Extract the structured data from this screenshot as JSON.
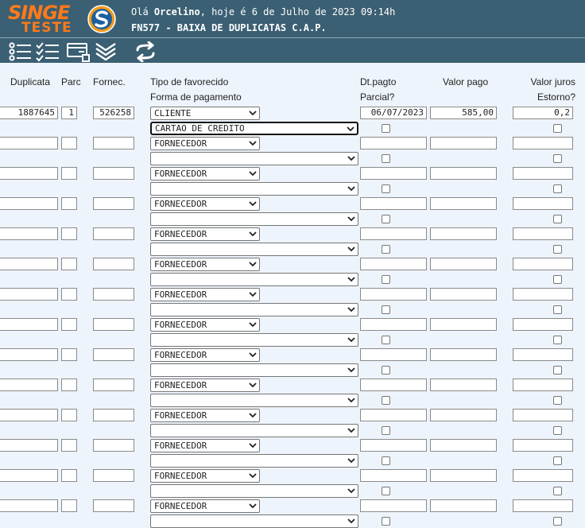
{
  "header": {
    "logo_line1": "SINGE",
    "logo_line2": "TESTE",
    "greeting_prefix": "Olá ",
    "user_name": "Orcelino",
    "greeting_suffix": ", hoje é 6 de Julho de 2023 09:14h",
    "program_title": "FN577 - BAIXA DE DUPLICATAS C.A.P."
  },
  "toolbar": {
    "icons": [
      "list-icon",
      "checklist-icon",
      "card-icon",
      "double-chevron-down-icon",
      "swap-arrows-icon"
    ]
  },
  "columns": {
    "duplicata": "Duplicata",
    "parc": "Parc",
    "fornec": "Fornec.",
    "tipo_favorecido": "Tipo de favorecido",
    "forma_pagamento": "Forma de pagamento",
    "dt_pagto": "Dt.pagto",
    "parcial": "Parcial?",
    "valor_pago": "Valor pago",
    "valor_juros": "Valor juros",
    "estorno": "Estorno?"
  },
  "colors": {
    "header_bg": "#3b5f73",
    "logo": "#ff7a1a",
    "page_bg": "#eef4fb"
  },
  "rows": [
    {
      "duplicata": "1887645",
      "parc": "1",
      "fornec": "526258",
      "tipo": "CLIENTE",
      "forma": "CARTAO DE CREDITO",
      "dt_pagto": "06/07/2023",
      "valor_pago": "585,00",
      "valor_juros": "0,2",
      "parcial": false,
      "estorno": false,
      "forma_focused": true
    },
    {
      "duplicata": "",
      "parc": "",
      "fornec": "",
      "tipo": "FORNECEDOR",
      "forma": "",
      "dt_pagto": "",
      "valor_pago": "",
      "valor_juros": "",
      "parcial": false,
      "estorno": false
    },
    {
      "duplicata": "",
      "parc": "",
      "fornec": "",
      "tipo": "FORNECEDOR",
      "forma": "",
      "dt_pagto": "",
      "valor_pago": "",
      "valor_juros": "",
      "parcial": false,
      "estorno": false
    },
    {
      "duplicata": "",
      "parc": "",
      "fornec": "",
      "tipo": "FORNECEDOR",
      "forma": "",
      "dt_pagto": "",
      "valor_pago": "",
      "valor_juros": "",
      "parcial": false,
      "estorno": false
    },
    {
      "duplicata": "",
      "parc": "",
      "fornec": "",
      "tipo": "FORNECEDOR",
      "forma": "",
      "dt_pagto": "",
      "valor_pago": "",
      "valor_juros": "",
      "parcial": false,
      "estorno": false
    },
    {
      "duplicata": "",
      "parc": "",
      "fornec": "",
      "tipo": "FORNECEDOR",
      "forma": "",
      "dt_pagto": "",
      "valor_pago": "",
      "valor_juros": "",
      "parcial": false,
      "estorno": false
    },
    {
      "duplicata": "",
      "parc": "",
      "fornec": "",
      "tipo": "FORNECEDOR",
      "forma": "",
      "dt_pagto": "",
      "valor_pago": "",
      "valor_juros": "",
      "parcial": false,
      "estorno": false
    },
    {
      "duplicata": "",
      "parc": "",
      "fornec": "",
      "tipo": "FORNECEDOR",
      "forma": "",
      "dt_pagto": "",
      "valor_pago": "",
      "valor_juros": "",
      "parcial": false,
      "estorno": false
    },
    {
      "duplicata": "",
      "parc": "",
      "fornec": "",
      "tipo": "FORNECEDOR",
      "forma": "",
      "dt_pagto": "",
      "valor_pago": "",
      "valor_juros": "",
      "parcial": false,
      "estorno": false
    },
    {
      "duplicata": "",
      "parc": "",
      "fornec": "",
      "tipo": "FORNECEDOR",
      "forma": "",
      "dt_pagto": "",
      "valor_pago": "",
      "valor_juros": "",
      "parcial": false,
      "estorno": false
    },
    {
      "duplicata": "",
      "parc": "",
      "fornec": "",
      "tipo": "FORNECEDOR",
      "forma": "",
      "dt_pagto": "",
      "valor_pago": "",
      "valor_juros": "",
      "parcial": false,
      "estorno": false
    },
    {
      "duplicata": "",
      "parc": "",
      "fornec": "",
      "tipo": "FORNECEDOR",
      "forma": "",
      "dt_pagto": "",
      "valor_pago": "",
      "valor_juros": "",
      "parcial": false,
      "estorno": false
    },
    {
      "duplicata": "",
      "parc": "",
      "fornec": "",
      "tipo": "FORNECEDOR",
      "forma": "",
      "dt_pagto": "",
      "valor_pago": "",
      "valor_juros": "",
      "parcial": false,
      "estorno": false
    },
    {
      "duplicata": "",
      "parc": "",
      "fornec": "",
      "tipo": "FORNECEDOR",
      "forma": "",
      "dt_pagto": "",
      "valor_pago": "",
      "valor_juros": "",
      "parcial": false,
      "estorno": false
    }
  ]
}
